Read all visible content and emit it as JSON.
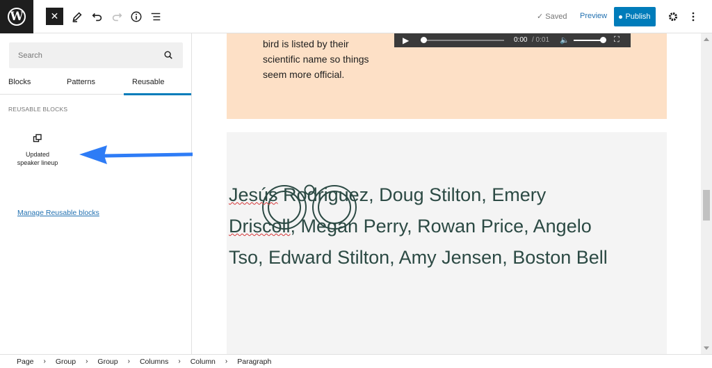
{
  "topbar": {
    "close_label": "✕",
    "saved_label": "Saved",
    "preview_label": "Preview",
    "publish_label": "Publish"
  },
  "sidebar": {
    "search_placeholder": "Search",
    "tabs": [
      {
        "label": "Blocks"
      },
      {
        "label": "Patterns"
      },
      {
        "label": "Reusable"
      }
    ],
    "section_label": "REUSABLE BLOCKS",
    "block_item": {
      "label_line1": "Updated",
      "label_line2": "speaker lineup"
    },
    "manage_link": "Manage Reusable blocks"
  },
  "canvas": {
    "peach_text": "bird is listed by their scientific name so things seem more official.",
    "audio_time": "0:00",
    "audio_duration": "/ 0:01",
    "names_line1_a": "Jesús",
    "names_line1_b": " Rodriguez, Doug Stilton, Emery",
    "names_line2_a": "Driscoll",
    "names_line2_b": ", Megan Perry, Rowan Price, Angelo",
    "names_line3": "Tso, Edward Stilton, Amy Jensen, Boston Bell"
  },
  "breadcrumb": [
    "Page",
    "Group",
    "Group",
    "Columns",
    "Column",
    "Paragraph"
  ],
  "colors": {
    "accent": "#007cba",
    "peach": "#fde0c6",
    "names_text": "#2c4a44",
    "arrow": "#2e7cf6"
  }
}
